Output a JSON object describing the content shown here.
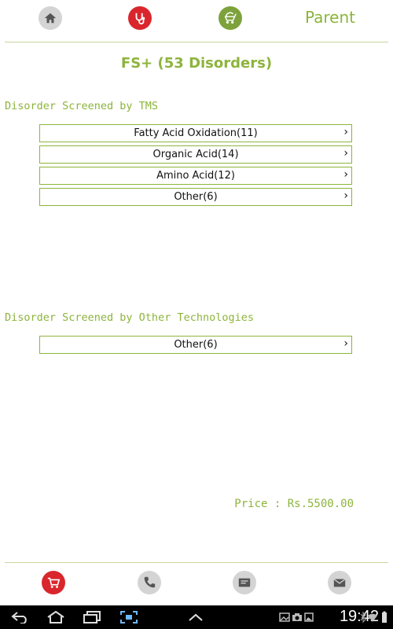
{
  "header": {
    "nav_icons": [
      "home-icon",
      "stethoscope-icon",
      "baby-stroller-icon"
    ],
    "parent_label": "Parent"
  },
  "page": {
    "title": "FS+ (53 Disorders)"
  },
  "sections": [
    {
      "title": "Disorder Screened by TMS",
      "items": [
        {
          "label": "Fatty Acid Oxidation(11)"
        },
        {
          "label": "Organic Acid(14)"
        },
        {
          "label": "Amino Acid(12)"
        },
        {
          "label": "Other(6)"
        }
      ]
    },
    {
      "title": "Disorder Screened by Other Technologies",
      "items": [
        {
          "label": "Other(6)"
        }
      ]
    }
  ],
  "chevron": "›",
  "price": "Price : Rs.5500.00",
  "footer": {
    "icons": [
      "cart-icon",
      "phone-icon",
      "message-icon",
      "mail-icon"
    ]
  },
  "system_bar": {
    "time": "19:42"
  },
  "colors": {
    "accent": "#8db43c",
    "red": "#d9262c",
    "grey_icon": "#d4d4d4"
  }
}
